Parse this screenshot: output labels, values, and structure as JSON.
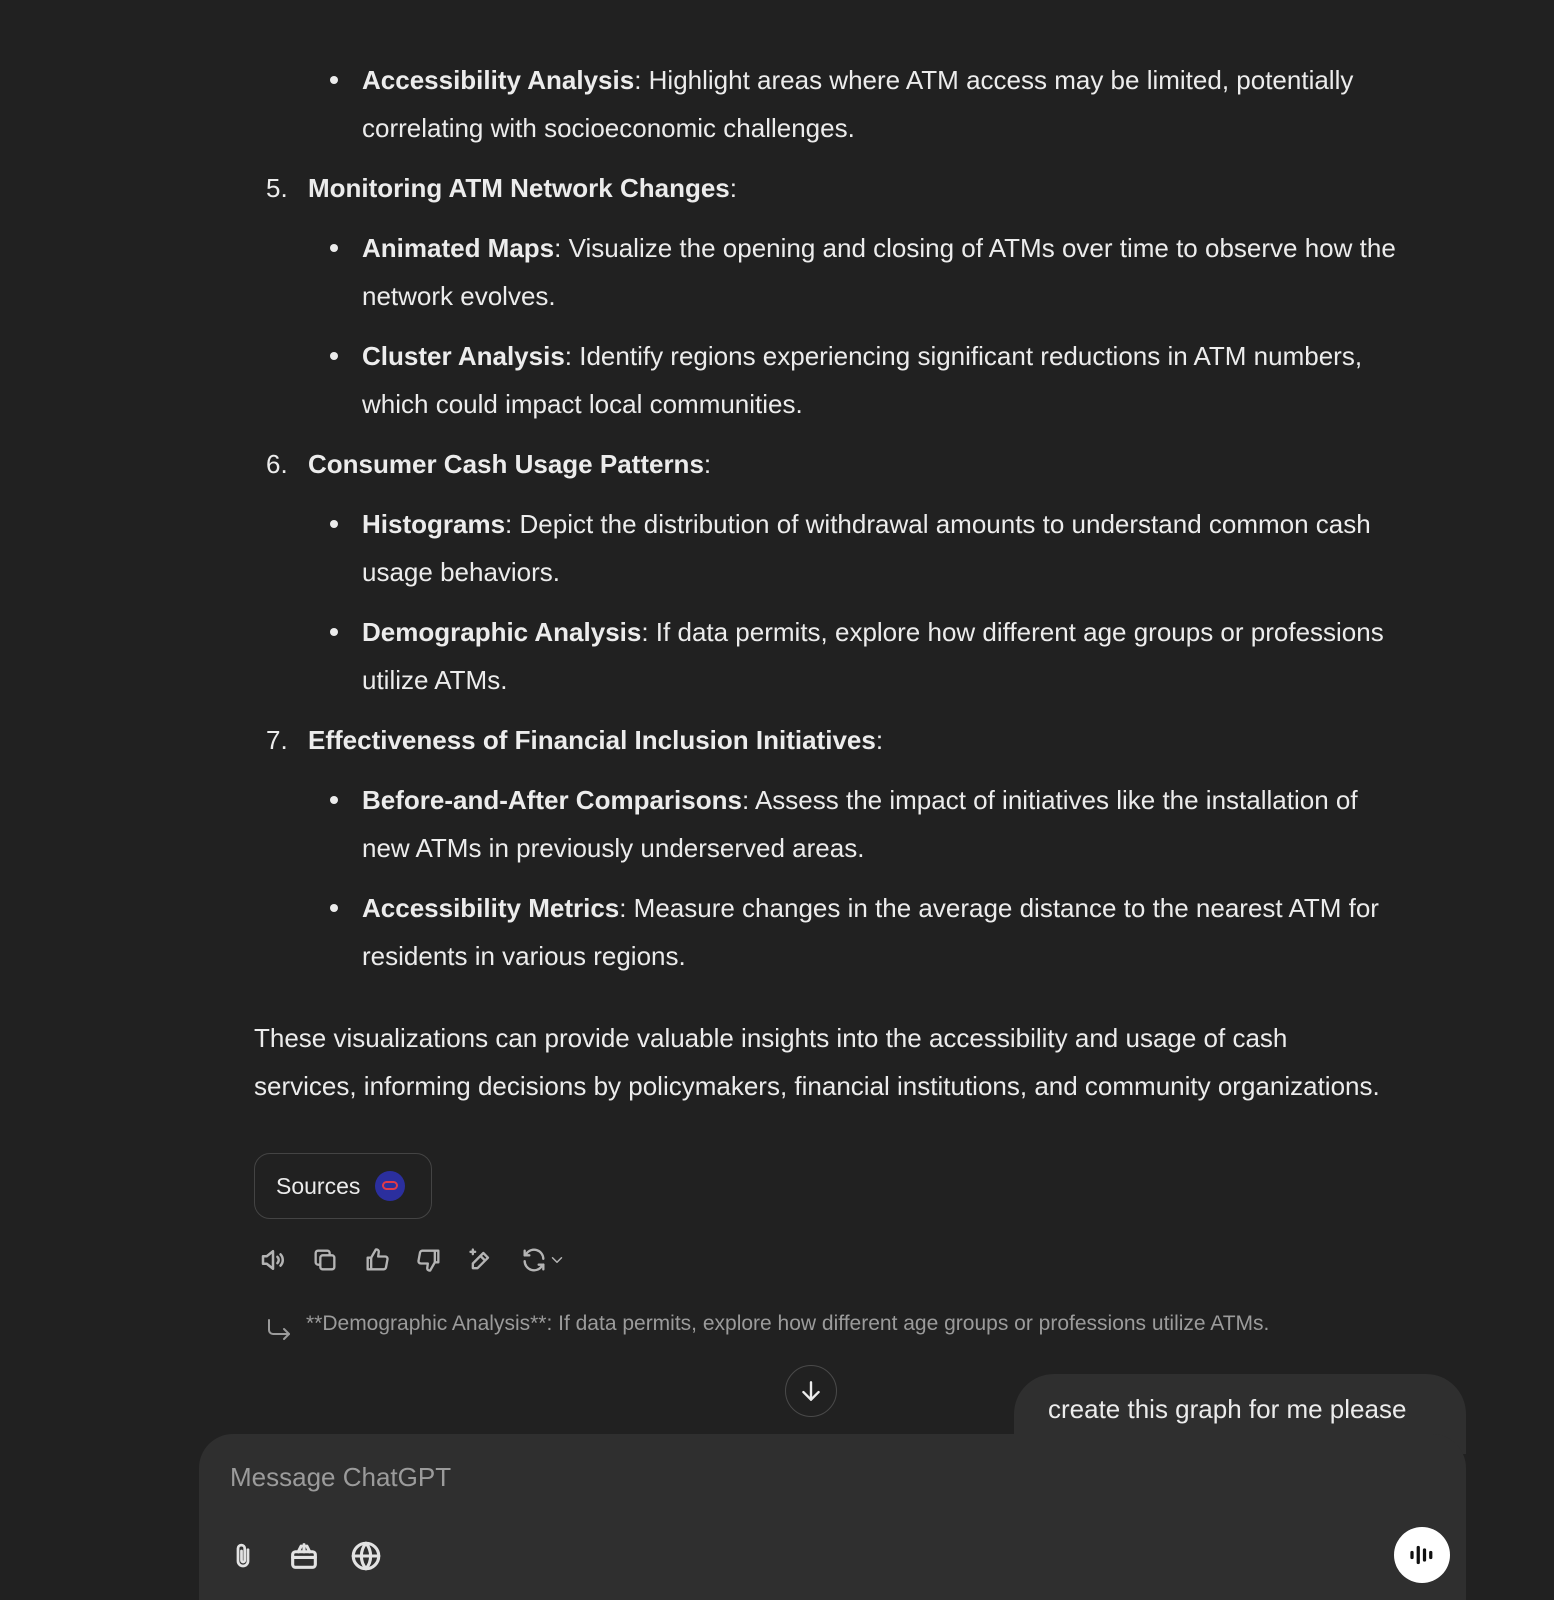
{
  "response": {
    "list_intro_bullets": [
      {
        "bold": "Accessibility Analysis",
        "text": ": Highlight areas where ATM access may be limited, potentially",
        "text2": "correlating with socioeconomic challenges."
      }
    ],
    "sections": [
      {
        "number": "5.",
        "title": "Monitoring ATM Network Changes",
        "bullets": [
          {
            "bold": "Animated Maps",
            "line1": ": Visualize the opening and closing of ATMs over time to observe how the",
            "line2": "network evolves."
          },
          {
            "bold": "Cluster Analysis",
            "line1": ": Identify regions experiencing significant reductions in ATM numbers,",
            "line2": "which could impact local communities."
          }
        ]
      },
      {
        "number": "6.",
        "title": "Consumer Cash Usage Patterns",
        "bullets": [
          {
            "bold": "Histograms",
            "line1": ": Depict the distribution of withdrawal amounts to understand common cash",
            "line2": "usage behaviors."
          },
          {
            "bold": "Demographic Analysis",
            "line1": ": If data permits, explore how different age groups or professions",
            "line2": "utilize ATMs."
          }
        ]
      },
      {
        "number": "7.",
        "title": "Effectiveness of Financial Inclusion Initiatives",
        "bullets": [
          {
            "bold": "Before-and-After Comparisons",
            "line1": ": Assess the impact of initiatives like the installation of",
            "line2": "new ATMs in previously underserved areas."
          },
          {
            "bold": "Accessibility Metrics",
            "line1": ": Measure changes in the average distance to the nearest ATM for",
            "line2": "residents in various regions."
          }
        ]
      }
    ],
    "closing_line1": "These visualizations can provide valuable insights into the accessibility and usage of cash",
    "closing_line2": "services, informing decisions by policymakers, financial institutions, and community organizations."
  },
  "sources_label": "Sources",
  "action_icons": [
    "speaker-icon",
    "copy-icon",
    "thumbs-up-icon",
    "thumbs-down-icon",
    "edit-sparkle-icon",
    "regenerate-icon",
    "chevron-down-icon"
  ],
  "quoted_reply": "**Demographic Analysis**: If data permits, explore how different age groups or professions utilize ATMs.",
  "user_message": "create this graph for me please",
  "composer": {
    "placeholder": "Message ChatGPT",
    "tools": [
      "attach-icon",
      "tools-icon",
      "globe-icon"
    ]
  },
  "colors": {
    "background": "#212121",
    "surface": "#2f2f2f",
    "text": "#ececec",
    "muted": "#9b9b9b"
  }
}
